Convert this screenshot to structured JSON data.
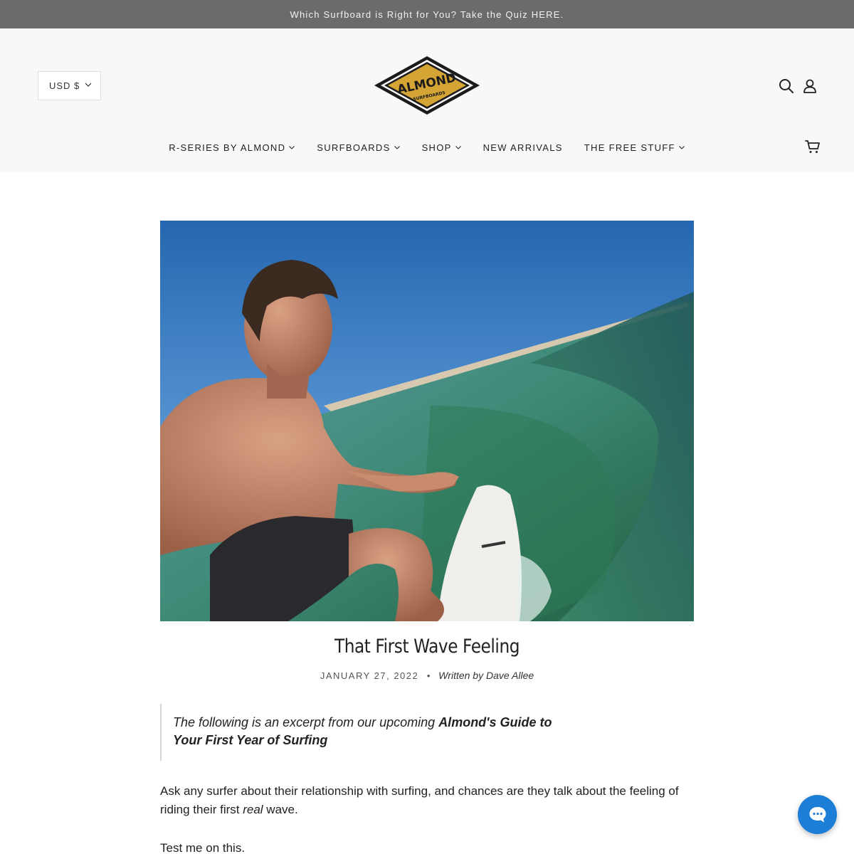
{
  "announcement": {
    "text": "Which Surfboard is Right for You? Take the Quiz HERE."
  },
  "header": {
    "currency": "USD $",
    "logo": {
      "name": "ALMOND",
      "sub": "SURFBOARDS",
      "accent": "#d4a434"
    },
    "nav": [
      {
        "label": "R-SERIES BY ALMOND",
        "has_dropdown": true
      },
      {
        "label": "SURFBOARDS",
        "has_dropdown": true
      },
      {
        "label": "SHOP",
        "has_dropdown": true
      },
      {
        "label": "NEW ARRIVALS",
        "has_dropdown": false
      },
      {
        "label": "THE FREE STUFF",
        "has_dropdown": true
      }
    ],
    "icons": [
      "search-icon",
      "account-icon",
      "cart-icon"
    ]
  },
  "article": {
    "hero_image": "surfer-on-wave-photo",
    "title": "That First Wave Feeling",
    "date": "JANUARY 27, 2022",
    "separator": "•",
    "author": "Written by Dave Allee",
    "quote": {
      "prefix": "The following is an excerpt from our upcoming ",
      "bold": "Almond's Guide to Your First Year of Surfing"
    },
    "paragraph1": {
      "before": "Ask any surfer about their relationship with surfing, and chances are they talk about the feeling of riding their first ",
      "emphasis": "real",
      "after": " wave."
    },
    "paragraph2": "Test me on this."
  },
  "chat": {
    "icon": "chat-bubble-icon",
    "color": "#1d7ed7"
  }
}
